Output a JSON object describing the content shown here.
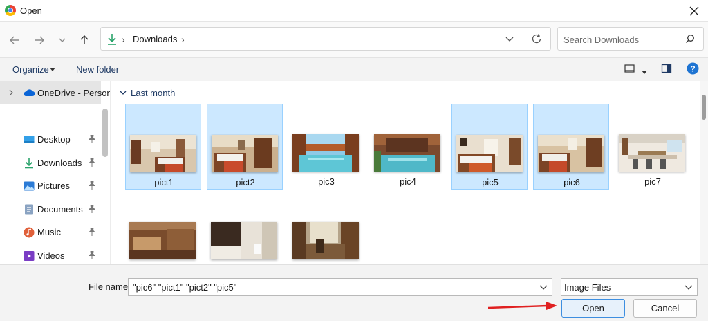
{
  "window": {
    "title": "Open"
  },
  "address": {
    "path": [
      "Downloads"
    ]
  },
  "search": {
    "placeholder": "Search Downloads"
  },
  "toolbar": {
    "organize": "Organize",
    "new_folder": "New folder"
  },
  "sidebar": {
    "top": "OneDrive - Personal",
    "items": [
      {
        "label": "Desktop",
        "icon": "desktop-icon"
      },
      {
        "label": "Downloads",
        "icon": "download-icon"
      },
      {
        "label": "Pictures",
        "icon": "pictures-icon"
      },
      {
        "label": "Documents",
        "icon": "documents-icon"
      },
      {
        "label": "Music",
        "icon": "music-icon"
      },
      {
        "label": "Videos",
        "icon": "videos-icon"
      }
    ]
  },
  "group": {
    "label": "Last month"
  },
  "files": [
    {
      "name": "pict1",
      "selected": true
    },
    {
      "name": "pict2",
      "selected": true
    },
    {
      "name": "pic3",
      "selected": false
    },
    {
      "name": "pic4",
      "selected": false
    },
    {
      "name": "pic5",
      "selected": true
    },
    {
      "name": "pic6",
      "selected": true
    },
    {
      "name": "pic7",
      "selected": false
    },
    {
      "name": "",
      "selected": false
    },
    {
      "name": "",
      "selected": false
    },
    {
      "name": "",
      "selected": false
    }
  ],
  "footer": {
    "filename_label": "File name:",
    "filename_value": "\"pic6\" \"pict1\" \"pict2\" \"pic5\"",
    "filetype": "Image Files",
    "open_label": "Open",
    "cancel_label": "Cancel"
  },
  "colors": {
    "selection": "#cce8ff",
    "accent": "#0067c0",
    "arrow": "#e02020"
  }
}
